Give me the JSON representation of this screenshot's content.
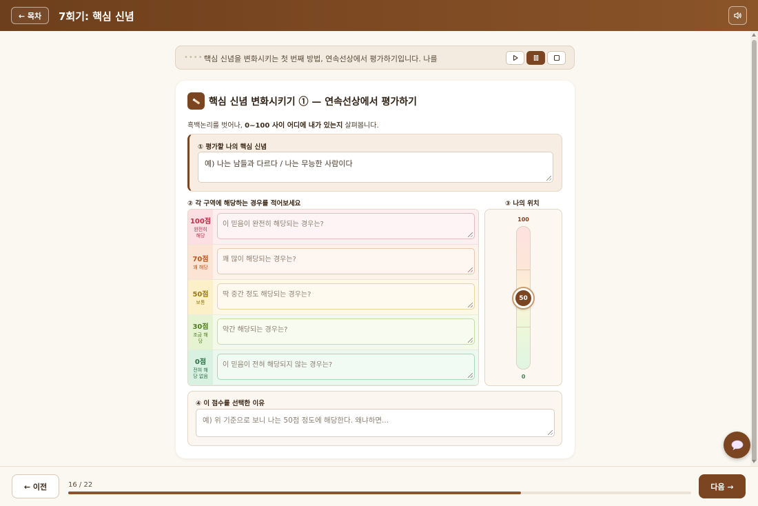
{
  "header": {
    "back_label": "← 목차",
    "title": "7회기: 핵심 신념",
    "sound_icon": "speaker-icon"
  },
  "tts": {
    "dots": "••••••",
    "text": "핵심 신념을 변화시키는 첫 번째 방법, 연속선상에서 평가하기입니다. 나를…",
    "controls": [
      "play-icon",
      "pause-icon",
      "stop-icon"
    ],
    "active_control": "pause-icon"
  },
  "card": {
    "icon": "pencil-icon",
    "title": "핵심 신념 변화시키기 ① — 연속선상에서 평가하기",
    "desc_prefix": "흑백논리를 벗어나, ",
    "desc_bold": "0~100 사이 어디에 내가 있는지",
    "desc_suffix": " 살펴봅니다.",
    "section1": {
      "label": "① 평가할 나의 핵심 신념",
      "value": "예) 나는 남들과 다르다 / 나는 무능한 사람이다"
    },
    "section2": {
      "label": "② 각 구역에 해당하는 경우를 적어보세요",
      "zones": [
        {
          "pts": "100점",
          "sub": "완전히 해당",
          "placeholder": "이 믿음이 완전히 해당되는 경우는?",
          "bg": "#fdeef0",
          "score_bg": "#fbdfe3",
          "color": "#b8324a",
          "border": "#e7b9c1"
        },
        {
          "pts": "70점",
          "sub": "꽤 해당",
          "placeholder": "꽤 많이 해당되는 경우는?",
          "bg": "#fdf2ea",
          "score_bg": "#fbe4d3",
          "color": "#b8561c",
          "border": "#eac7ad"
        },
        {
          "pts": "50점",
          "sub": "보통",
          "placeholder": "딱 중간 정도 해당되는 경우는?",
          "bg": "#fdf8e6",
          "score_bg": "#fbf0c8",
          "color": "#9a7a10",
          "border": "#e6d69a"
        },
        {
          "pts": "30점",
          "sub": "조금 해당",
          "placeholder": "약간 해당되는 경우는?",
          "bg": "#f4fae9",
          "score_bg": "#e6f3d2",
          "color": "#4e7d22",
          "border": "#c4dca4"
        },
        {
          "pts": "0점",
          "sub": "전혀 해당 없음",
          "placeholder": "이 믿음이 전혀 해당되지 않는 경우는?",
          "bg": "#ebf8ef",
          "score_bg": "#d8f1e1",
          "color": "#2f7048",
          "border": "#a9d6b8"
        }
      ]
    },
    "section3": {
      "label": "③ 나의 위치",
      "top": "100",
      "bottom": "0",
      "value": "50"
    },
    "section4": {
      "label": "④ 이 점수를 선택한 이유",
      "placeholder": "예) 위 기준으로 보니 나는 50점 정도에 해당한다. 왜냐하면..."
    }
  },
  "footer": {
    "prev_label": "← 이전",
    "progress_text": "16 / 22",
    "progress_value": 0.7273,
    "next_label": "다음 →"
  },
  "chat_icon": "chat-bubble-icon"
}
